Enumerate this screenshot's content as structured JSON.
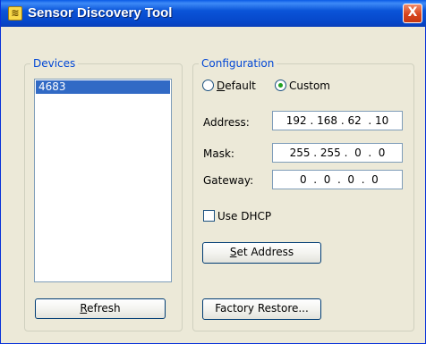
{
  "window": {
    "title": "Sensor Discovery Tool",
    "app_icon": "app-icon",
    "close_label": "X"
  },
  "devices": {
    "legend": "Devices",
    "items": [
      "4683"
    ],
    "refresh_label": "Refresh",
    "refresh_accesskey": "R"
  },
  "configuration": {
    "legend": "Configuration",
    "mode_options": [
      {
        "label": "Default",
        "selected": false
      },
      {
        "label": "Custom",
        "selected": true
      }
    ],
    "address_label": "Address:",
    "address_value": "192 . 168 . 62  . 10",
    "mask_label": "Mask:",
    "mask_value": "255 . 255 .  0  .  0",
    "gateway_label": "Gateway:",
    "gateway_value": " 0  .  0  .  0  .  0",
    "dhcp_label": "Use DHCP",
    "dhcp_checked": false,
    "set_address_label": "Set Address",
    "factory_restore_label": "Factory Restore..."
  },
  "colors": {
    "title_bar": "#0a54d8",
    "selection": "#316ac5",
    "group_legend": "#0046d5",
    "close_button": "#d8441c"
  }
}
